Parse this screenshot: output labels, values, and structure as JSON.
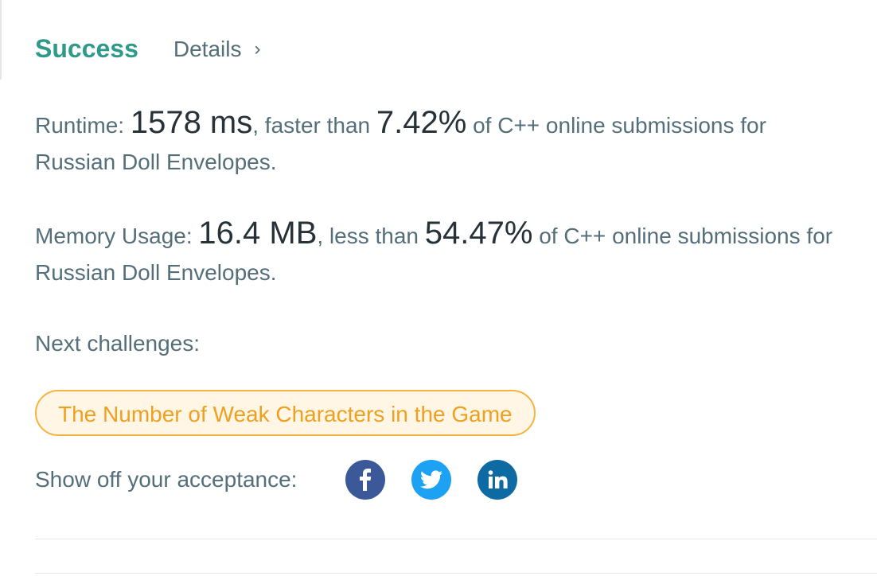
{
  "header": {
    "status": "Success",
    "details_label": "Details",
    "status_color": "#2e9a8a"
  },
  "runtime": {
    "label": "Runtime: ",
    "value": "1578 ms",
    "middle": ", faster than ",
    "percent": "7.42%",
    "suffix": " of C++ online submissions for",
    "problem": "Russian Doll Envelopes."
  },
  "memory": {
    "label": "Memory Usage: ",
    "value": "16.4 MB",
    "middle": ", less than ",
    "percent": "54.47%",
    "suffix": " of C++ online submissions for",
    "problem": "Russian Doll Envelopes."
  },
  "next_challenges": {
    "label": "Next challenges:",
    "items": [
      {
        "title": "The Number of Weak Characters in the Game",
        "color": "#f0a020"
      }
    ]
  },
  "share": {
    "label": "Show off your acceptance:",
    "icons": [
      {
        "name": "facebook-icon",
        "color": "#3b5998"
      },
      {
        "name": "twitter-icon",
        "color": "#1da1f2"
      },
      {
        "name": "linkedin-icon",
        "color": "#0e6aa2"
      }
    ]
  }
}
